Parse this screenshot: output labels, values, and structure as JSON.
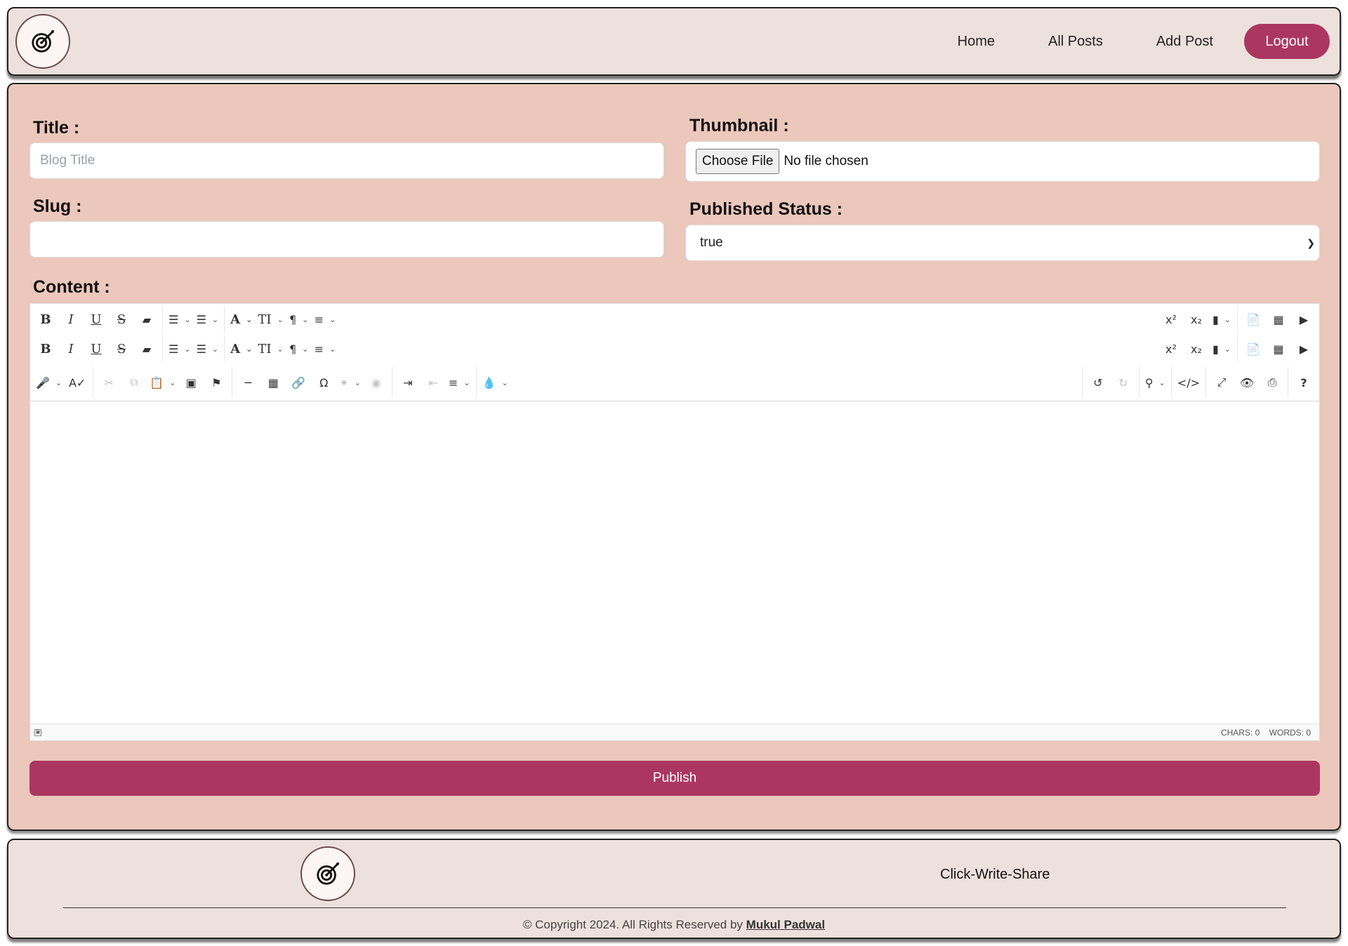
{
  "header": {
    "logo_text": "Click-Write-Share",
    "nav": [
      "Home",
      "All Posts",
      "Add Post"
    ],
    "logout_label": "Logout"
  },
  "form": {
    "title_label": "Title :",
    "title_placeholder": "Blog Title",
    "title_value": "",
    "slug_label": "Slug :",
    "slug_value": "",
    "thumbnail_label": "Thumbnail :",
    "choose_file_label": "Choose File",
    "file_status": "No file chosen",
    "status_label": "Published Status :",
    "status_selected": "true",
    "content_label": "Content :",
    "publish_label": "Publish"
  },
  "editor": {
    "format_row_icons": [
      "bold-icon",
      "italic-icon",
      "underline-icon",
      "strikethrough-icon",
      "eraser-icon",
      "bullet-list-icon",
      "numbered-list-icon",
      "font-icon",
      "font-size-icon",
      "paragraph-icon",
      "line-height-icon",
      "superscript-icon",
      "subscript-icon",
      "class-span-icon",
      "file-icon",
      "image-icon",
      "video-icon"
    ],
    "tools_row_icons": [
      "microphone-icon",
      "spellcheck-icon",
      "cut-icon",
      "copy-icon",
      "paste-icon",
      "select-all-icon",
      "copy-format-icon",
      "horizontal-rule-icon",
      "table-icon",
      "link-icon",
      "special-char-icon",
      "ai-assistant-icon",
      "ai-commands-icon",
      "indent-icon",
      "outdent-icon",
      "align-icon",
      "brush-icon",
      "undo-icon",
      "redo-icon",
      "find-icon",
      "source-icon",
      "fullsize-icon",
      "preview-icon",
      "print-icon",
      "help-icon"
    ],
    "chars_label": "CHARS: 0",
    "words_label": "WORDS: 0"
  },
  "footer": {
    "brand": "Click-Write-Share",
    "copyright": "© Copyright 2024. All Rights Reserved by",
    "author": "Mukul Padwal"
  },
  "colors": {
    "accent": "#ab3760",
    "card_bg": "#ecc7bb",
    "header_bg": "#ede1dd"
  }
}
